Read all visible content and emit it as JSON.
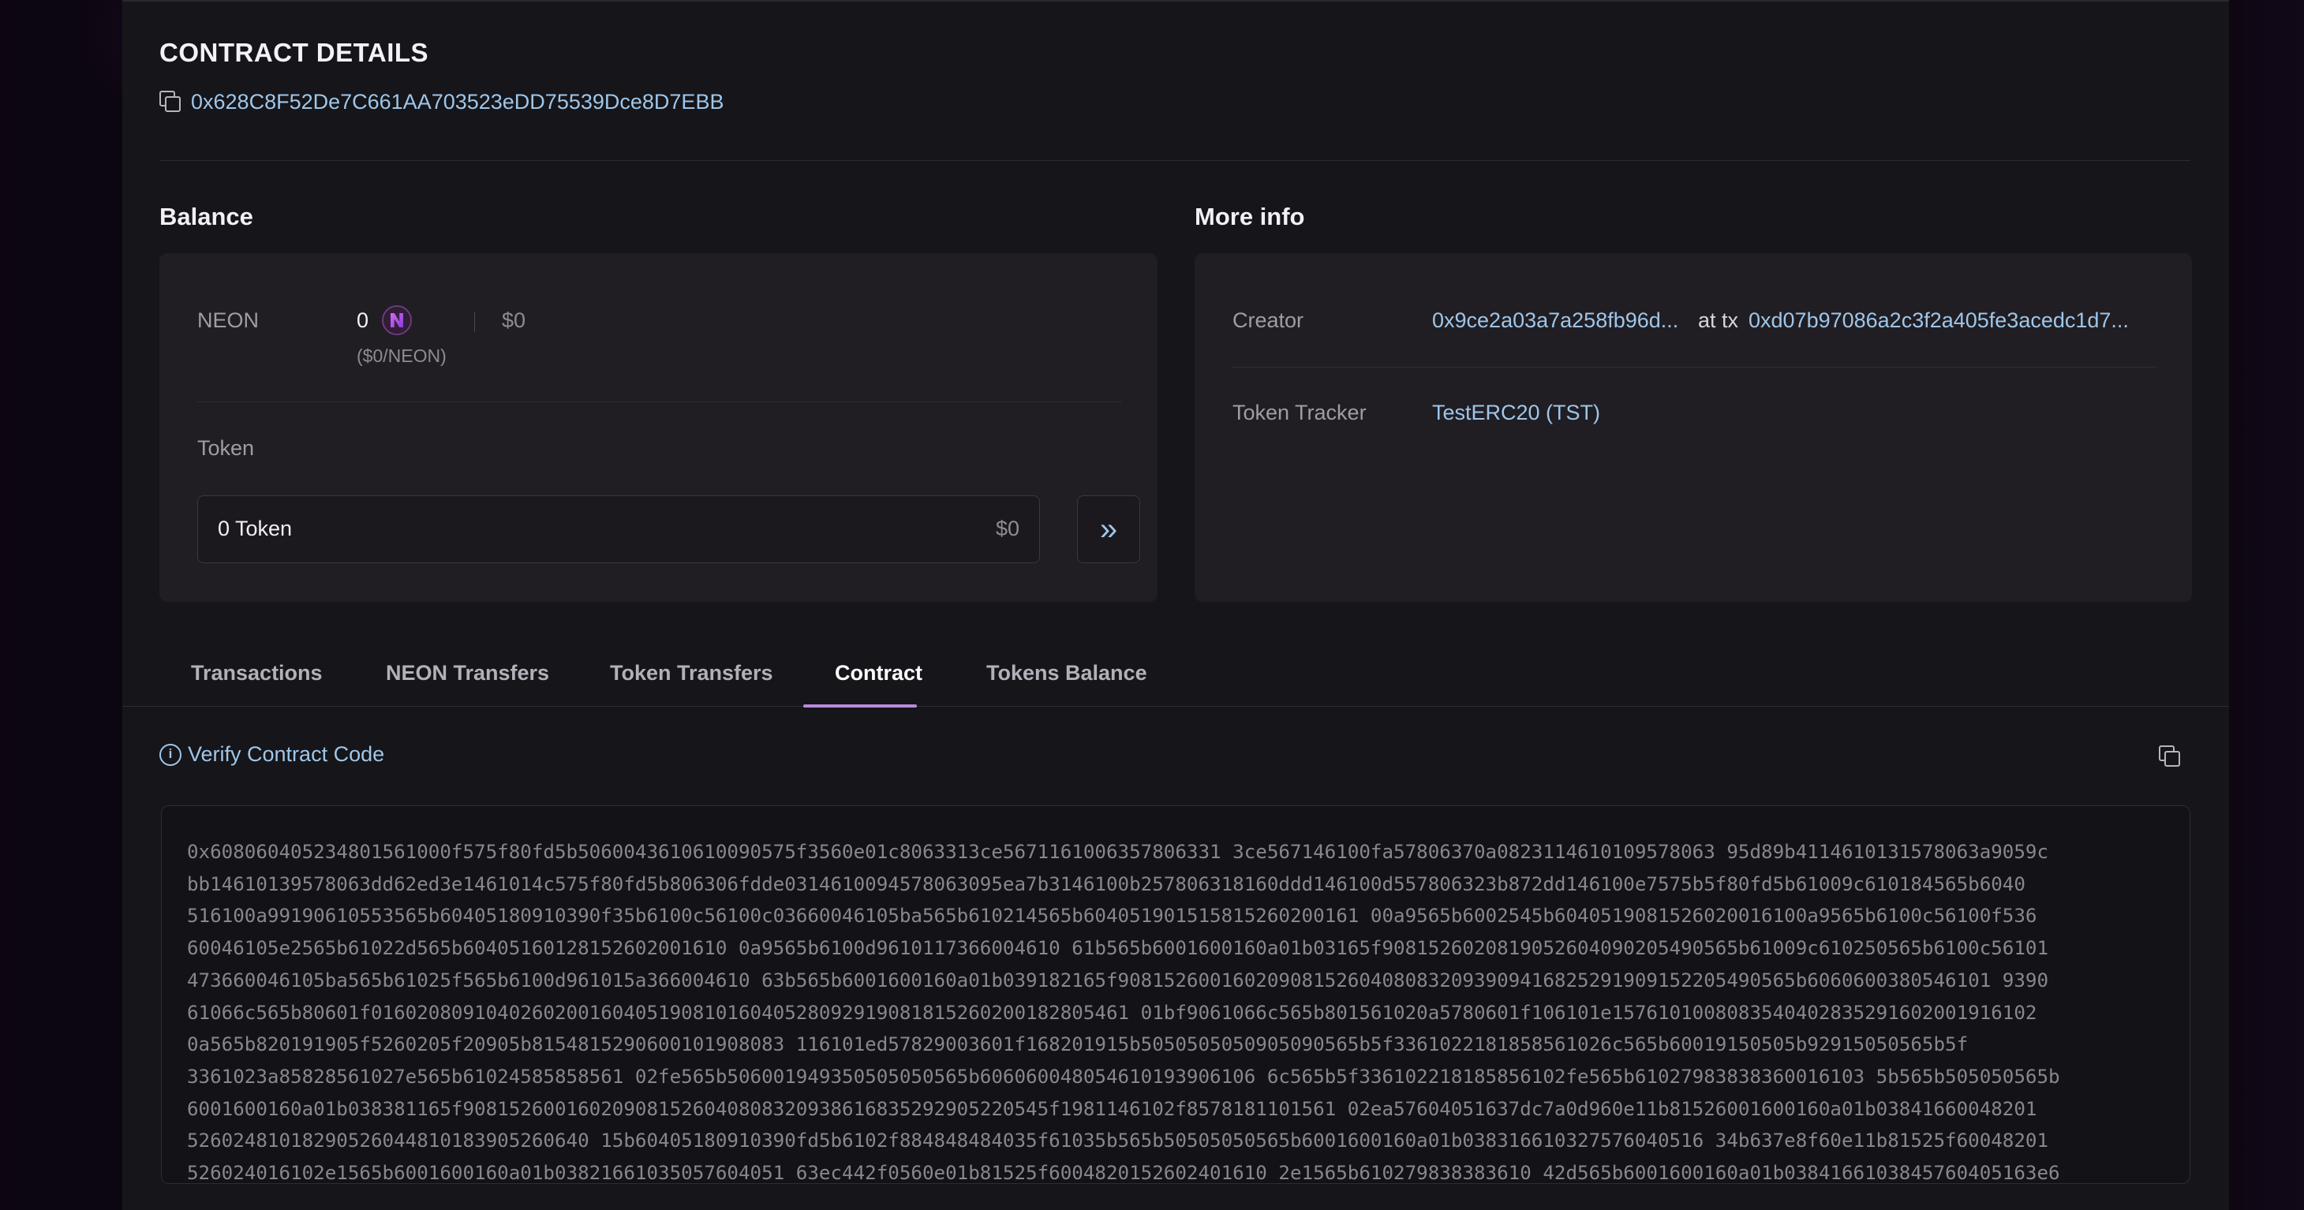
{
  "header": {
    "title": "CONTRACT DETAILS",
    "address": "0x628C8F52De7C661AA703523eDD75539Dce8D7EBB"
  },
  "balance": {
    "title": "Balance",
    "neon_label": "NEON",
    "neon_amount": "0",
    "neon_usd": "$0",
    "neon_rate": "($0/NEON)",
    "token_label": "Token",
    "token_value": "0 Token",
    "token_usd": "$0",
    "expand_icon": "double-chevron-right"
  },
  "more_info": {
    "title": "More info",
    "creator_label": "Creator",
    "creator_address": "0x9ce2a03a7a258fb96d...",
    "at_tx_label": "at tx",
    "creator_tx": "0xd07b97086a2c3f2a405fe3acedc1d7...",
    "tracker_label": "Token Tracker",
    "tracker_value": "TestERC20 (TST)"
  },
  "tabs": [
    {
      "label": "Transactions"
    },
    {
      "label": "NEON Transfers"
    },
    {
      "label": "Token Transfers"
    },
    {
      "label": "Contract",
      "active": true
    },
    {
      "label": "Tokens Balance"
    }
  ],
  "contract": {
    "verify_label": "Verify Contract Code",
    "bytecode_lines": [
      "0x608060405234801561000f575f80fd5b5060043610610090575f3560e01c8063313ce5671161006357806331 3ce567146100fa57806370a0823114610109578063 95d89b4114610131578063a9059c",
      "bb14610139578063dd62ed3e1461014c575f80fd5b806306fdde0314610094578063095ea7b3146100b257806318160ddd146100d557806323b872dd146100e7575b5f80fd5b61009c610184565b6040",
      "516100a99190610553565b60405180910390f35b6100c56100c03660046105ba565b610214565b604051901515815260200161 00a9565b6002545b6040519081526020016100a9565b6100c56100f536",
      "60046105e2565b61022d565b60405160128152602001610 0a9565b6100d9610117366004610 61b565b6001600160a01b03165f9081526020819052604090205490565b61009c610250565b6100c56101",
      "473660046105ba565b61025f565b6100d961015a366004610 63b565b6001600160a01b039182165f90815260016020908152604080832093909416825291909152205490565b6060600380546101 9390",
      "61066c565b80601f016020809104026020016040519081016040528092919081815260200182805461 01bf9061066c565b801561020a5780601f106101e1576101008083540402835291602001916102",
      "0a565b820191905f5260205f20905b8154815290600101908083 116101ed57829003601f168201915b5050505050905090565b5f3361022181858561026c565b60019150505b92915050565b5f",
      "3361023a85828561027e565b61024585858561 02fe565b506001949350505050565b606060048054610193906106 6c565b5f336102218185856102fe565b61027983838360016103 5b565b505050565b",
      "6001600160a01b038381165f908152600160209081526040808320938616835292905220545f1981146102f8578181101561 02ea57604051637dc7a0d960e11b81526001600160a01b03841660048201",
      "52602481018290526044810183905260640 15b60405180910390fd5b6102f884848484035f61035b565b50505050565b6001600160a01b038316610327576040516 34b637e8f60e11b81525f60048201",
      "526024016102e1565b6001600160a01b03821661035057604051 63ec442f0560e01b81525f6004820152602401610 2e1565b610279838383610 42d565b6001600160a01b0384166103845760405163e6"
    ]
  }
}
